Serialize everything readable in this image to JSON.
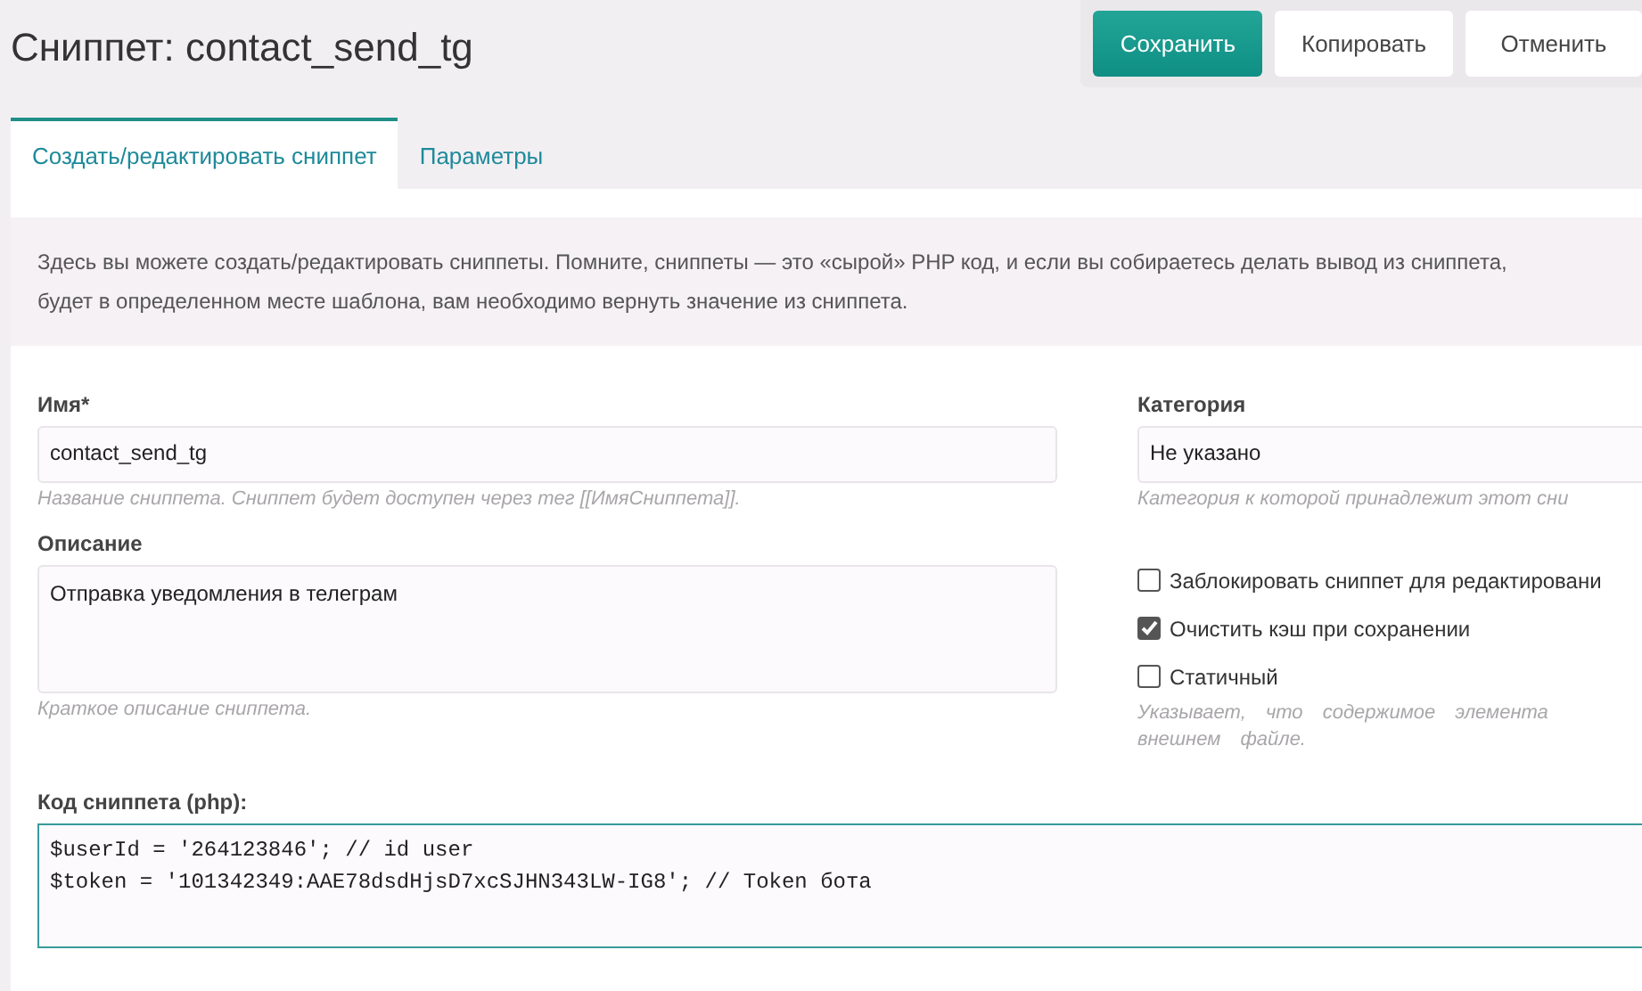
{
  "header": {
    "title": "Сниппет: contact_send_tg",
    "buttons": [
      {
        "label": "Сохранить",
        "kind": "primary"
      },
      {
        "label": "Копировать",
        "kind": "default"
      },
      {
        "label": "Отменить",
        "kind": "default"
      }
    ]
  },
  "tabs": [
    {
      "label": "Создать/редактировать сниппет",
      "selected": true
    },
    {
      "label": "Параметры",
      "selected": false
    }
  ],
  "intro": "Здесь вы можете создать/редактировать сниппеты. Помните, сниппеты — это «сырой» PHP код, и если вы собираетесь делать вывод из сниппета,\nбудет в определенном месте шаблона, вам необходимо вернуть значение из сниппета.",
  "name_field": {
    "label": "Имя*",
    "value": "contact_send_tg",
    "hint": "Название сниппета. Сниппет будет доступен через тег [[ИмяСниппета]]."
  },
  "description_field": {
    "label": "Описание",
    "value": "Отправка уведомления в телеграм",
    "hint": "Краткое описание сниппета."
  },
  "category_field": {
    "label": "Категория",
    "value": "Не указано",
    "hint": "Категория к которой принадлежит этот сни"
  },
  "options": [
    {
      "label": "Заблокировать сниппет для редактировани",
      "checked": false
    },
    {
      "label": "Очистить кэш при сохранении",
      "checked": true
    },
    {
      "label": "Статичный",
      "checked": false,
      "hint_lines": [
        "Указывает, что содержимое элемента",
        "внешнем файле."
      ]
    }
  ],
  "code": {
    "label": "Код сниппета (php):",
    "lines": [
      "$userId = '264123846'; // id user",
      "$token = '101342349:AAE78dsdHjsD7xcSJHN343LW-IG8'; // Token бота"
    ]
  }
}
